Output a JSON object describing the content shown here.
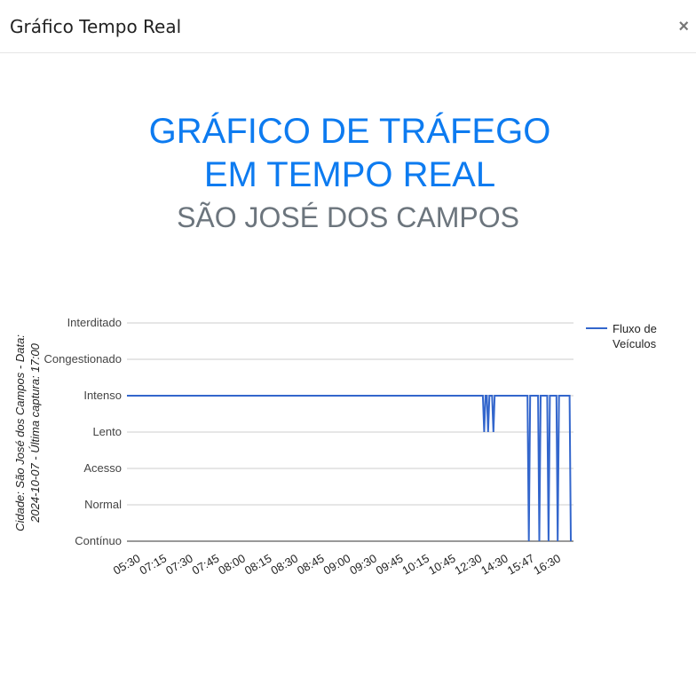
{
  "modal": {
    "title": "Gráfico Tempo Real",
    "close_label": "×"
  },
  "heading": {
    "line1": "GRÁFICO DE TRÁFEGO",
    "line2": "EM TEMPO REAL",
    "city": "SÃO JOSÉ DOS CAMPOS"
  },
  "chart_data": {
    "type": "line",
    "ylabel_line1": "Cidade: São José dos Campos - Data:",
    "ylabel_line2": "2024-10-07 - Última captura: 17:00",
    "y_categories": [
      "Contínuo",
      "Normal",
      "Acesso",
      "Lento",
      "Intenso",
      "Congestionado",
      "Interditado"
    ],
    "x_tick_labels": [
      "05:30",
      "07:15",
      "07:30",
      "07:45",
      "08:00",
      "08:15",
      "08:30",
      "08:45",
      "09:00",
      "09:30",
      "09:45",
      "10:15",
      "10:45",
      "12:30",
      "14:30",
      "15:47",
      "16:30"
    ],
    "legend": "top-right",
    "series": [
      {
        "name": "Fluxo de Veículos",
        "color": "#3366cc",
        "points": [
          {
            "x": 0,
            "y": "Intenso"
          },
          {
            "x": 13.55,
            "y": "Intenso"
          },
          {
            "x": 13.6,
            "y": "Lento"
          },
          {
            "x": 13.65,
            "y": "Intenso"
          },
          {
            "x": 13.7,
            "y": "Intenso"
          },
          {
            "x": 13.75,
            "y": "Lento"
          },
          {
            "x": 13.8,
            "y": "Intenso"
          },
          {
            "x": 13.9,
            "y": "Intenso"
          },
          {
            "x": 13.95,
            "y": "Lento"
          },
          {
            "x": 14.0,
            "y": "Intenso"
          },
          {
            "x": 15.25,
            "y": "Intenso"
          },
          {
            "x": 15.3,
            "y": "Contínuo"
          },
          {
            "x": 15.35,
            "y": "Intenso"
          },
          {
            "x": 15.65,
            "y": "Intenso"
          },
          {
            "x": 15.7,
            "y": "Contínuo"
          },
          {
            "x": 15.75,
            "y": "Intenso"
          },
          {
            "x": 16.0,
            "y": "Intenso"
          },
          {
            "x": 16.05,
            "y": "Contínuo"
          },
          {
            "x": 16.1,
            "y": "Intenso"
          },
          {
            "x": 16.35,
            "y": "Intenso"
          },
          {
            "x": 16.4,
            "y": "Contínuo"
          },
          {
            "x": 16.45,
            "y": "Intenso"
          },
          {
            "x": 16.85,
            "y": "Intenso"
          },
          {
            "x": 16.9,
            "y": "Contínuo"
          }
        ]
      }
    ],
    "grid": true
  }
}
